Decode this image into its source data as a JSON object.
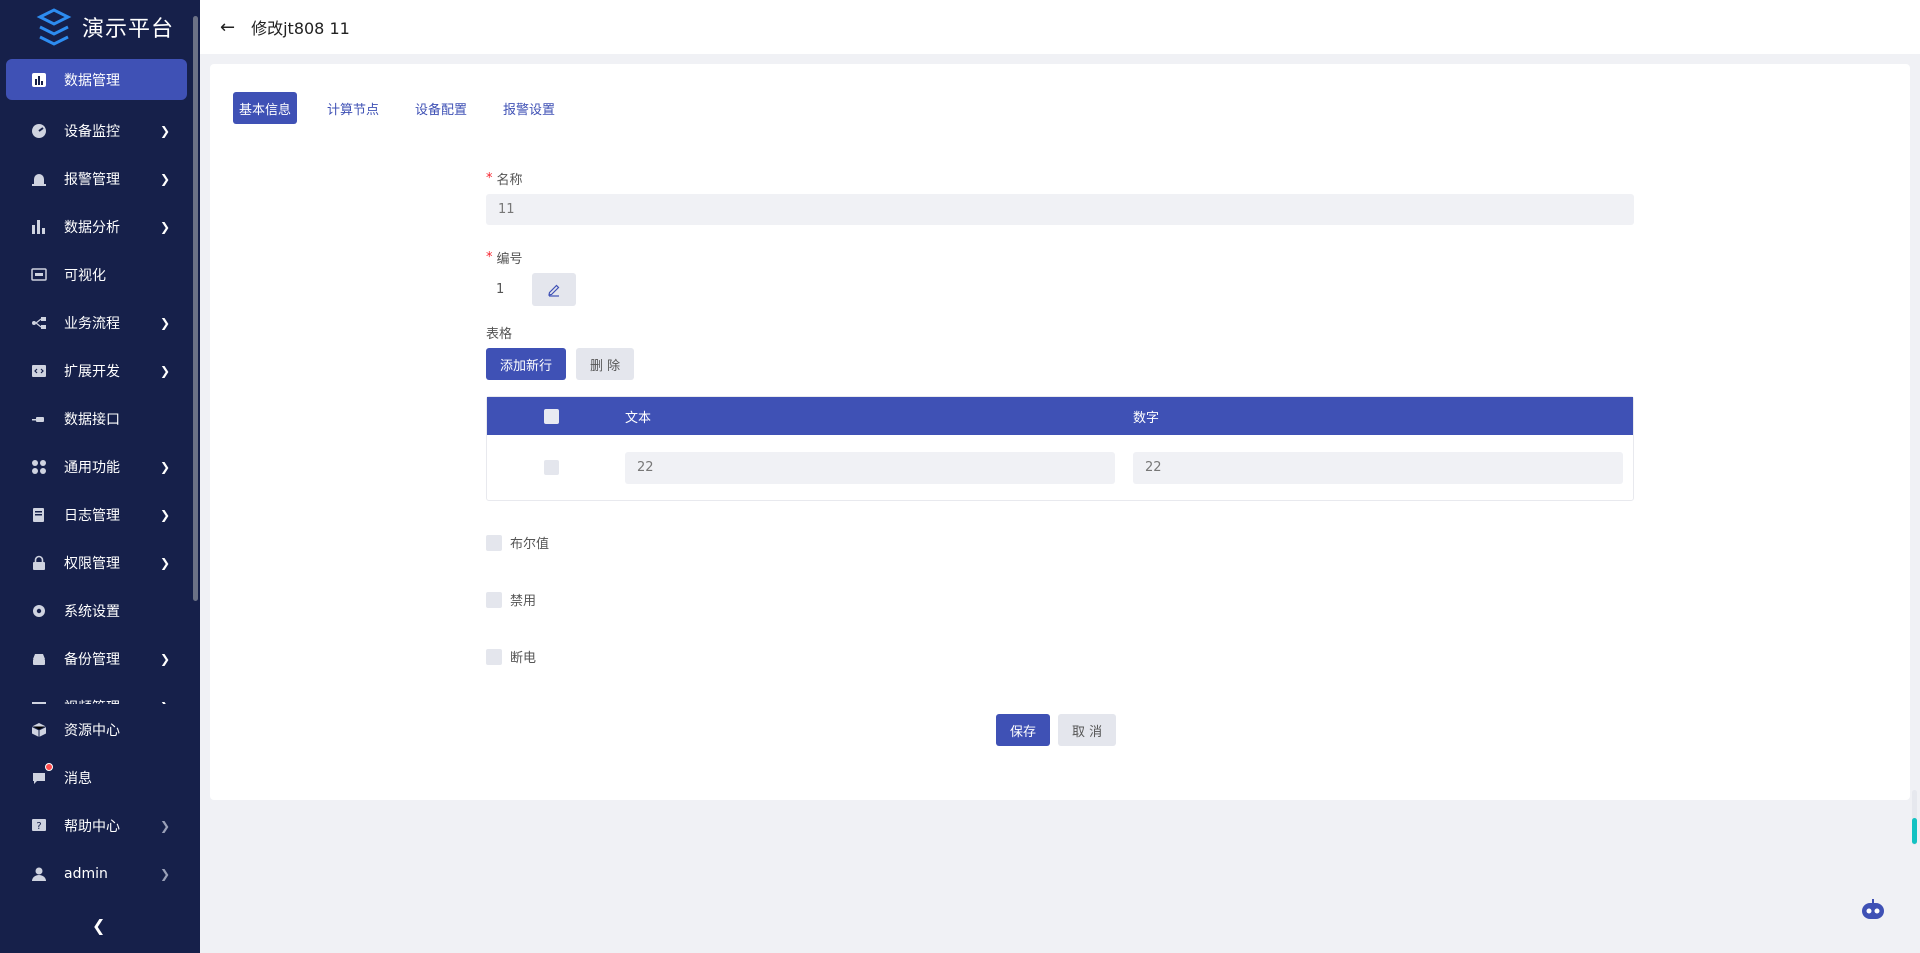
{
  "app": {
    "name": "演示平台"
  },
  "sidebar": {
    "items": [
      {
        "label": "数据管理",
        "icon": "bar-chart-icon",
        "active": true,
        "expandable": false
      },
      {
        "label": "设备监控",
        "icon": "monitor-gauge-icon",
        "expandable": true
      },
      {
        "label": "报警管理",
        "icon": "alarm-icon",
        "expandable": true
      },
      {
        "label": "数据分析",
        "icon": "analytics-icon",
        "expandable": true
      },
      {
        "label": "可视化",
        "icon": "screen-icon",
        "expandable": false
      },
      {
        "label": "业务流程",
        "icon": "flow-icon",
        "expandable": true
      },
      {
        "label": "扩展开发",
        "icon": "code-icon",
        "expandable": true
      },
      {
        "label": "数据接口",
        "icon": "plug-icon",
        "expandable": false
      },
      {
        "label": "通用功能",
        "icon": "apps-icon",
        "expandable": true
      },
      {
        "label": "日志管理",
        "icon": "log-icon",
        "expandable": true
      },
      {
        "label": "权限管理",
        "icon": "lock-icon",
        "expandable": true
      },
      {
        "label": "系统设置",
        "icon": "gear-icon",
        "expandable": false
      },
      {
        "label": "备份管理",
        "icon": "backup-icon",
        "expandable": true
      },
      {
        "label": "视频管理",
        "icon": "video-icon",
        "expandable": true
      }
    ],
    "bottom": [
      {
        "label": "资源中心",
        "icon": "cube-icon",
        "expandable": false
      },
      {
        "label": "消息",
        "icon": "message-icon",
        "expandable": false,
        "badge": true
      },
      {
        "label": "帮助中心",
        "icon": "help-icon",
        "expandable": true
      },
      {
        "label": "admin",
        "icon": "user-icon",
        "expandable": true
      }
    ]
  },
  "header": {
    "title": "修改jt808 11"
  },
  "tabs": [
    {
      "label": "基本信息",
      "active": true
    },
    {
      "label": "计算节点"
    },
    {
      "label": "设备配置"
    },
    {
      "label": "报警设置"
    }
  ],
  "form": {
    "name_label": "名称",
    "name_value": "11",
    "code_label": "编号",
    "code_value": "1",
    "table_label": "表格",
    "add_row_label": "添加新行",
    "delete_label": "删 除",
    "table": {
      "columns": [
        "文本",
        "数字"
      ],
      "rows": [
        {
          "text": "22",
          "number": "22"
        }
      ]
    },
    "checkboxes": [
      {
        "label": "布尔值",
        "checked": false
      },
      {
        "label": "禁用",
        "checked": false
      },
      {
        "label": "断电",
        "checked": false
      }
    ],
    "save_label": "保存",
    "cancel_label": "取 消"
  },
  "colors": {
    "sidebar_bg": "#16204a",
    "primary": "#3f51b5",
    "page_bg": "#f0f1f5"
  }
}
